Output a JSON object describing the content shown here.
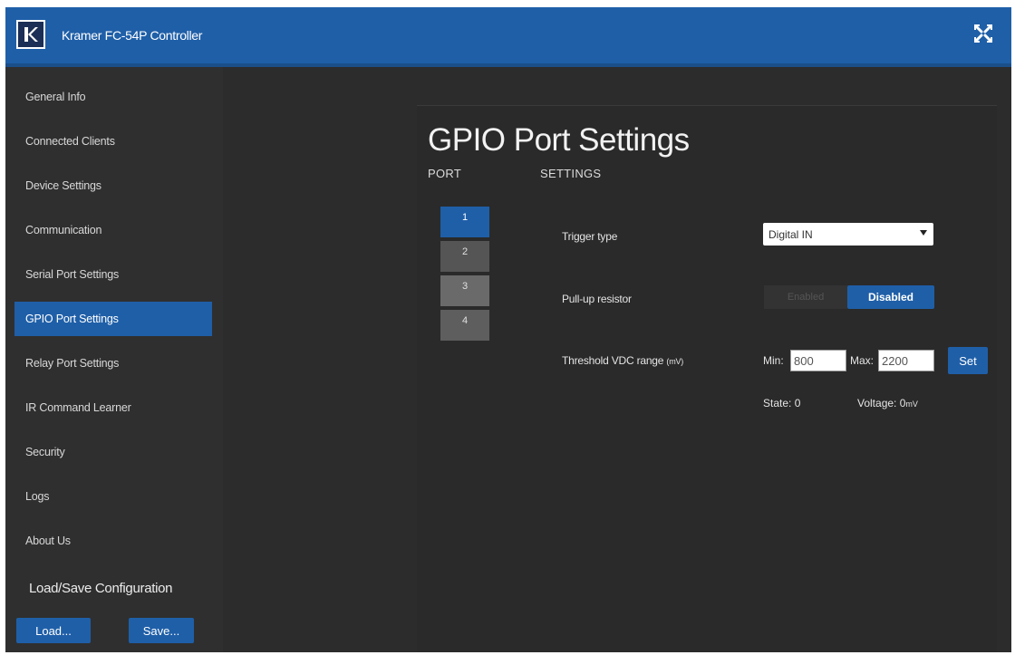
{
  "app": {
    "title": "Kramer FC-54P Controller"
  },
  "icons": {
    "logo": "kramer-logo",
    "close": "close-x-icon"
  },
  "colors": {
    "accent": "#1f5fa8",
    "background": "#2c2c2c"
  },
  "sidebar": {
    "items": [
      {
        "label": "General Info"
      },
      {
        "label": "Connected Clients"
      },
      {
        "label": "Device Settings"
      },
      {
        "label": "Communication"
      },
      {
        "label": "Serial Port Settings"
      },
      {
        "label": "GPIO Port Settings",
        "active": true
      },
      {
        "label": "Relay Port Settings"
      },
      {
        "label": "IR Command Learner"
      },
      {
        "label": "Security"
      },
      {
        "label": "Logs"
      },
      {
        "label": "About Us"
      }
    ],
    "load_save_title": "Load/Save Configuration",
    "load_label": "Load...",
    "save_label": "Save..."
  },
  "main": {
    "title": "GPIO Port Settings",
    "port_header": "PORT",
    "settings_header": "SETTINGS",
    "ports": [
      "1",
      "2",
      "3",
      "4"
    ],
    "selected_port": "1",
    "trigger_type_label": "Trigger type",
    "trigger_type_value": "Digital IN",
    "pullup_label": "Pull-up resistor",
    "pullup_off_label": "Enabled",
    "pullup_on_label": "Disabled",
    "threshold_label": "Threshold VDC range",
    "threshold_unit": "(mV)",
    "min_label": "Min:",
    "min_value": "800",
    "max_label": "Max:",
    "max_value": "2200",
    "set_label": "Set",
    "state_label": "State:",
    "state_value": "0",
    "voltage_label": "Voltage:",
    "voltage_value": "0",
    "voltage_unit": "mV"
  }
}
